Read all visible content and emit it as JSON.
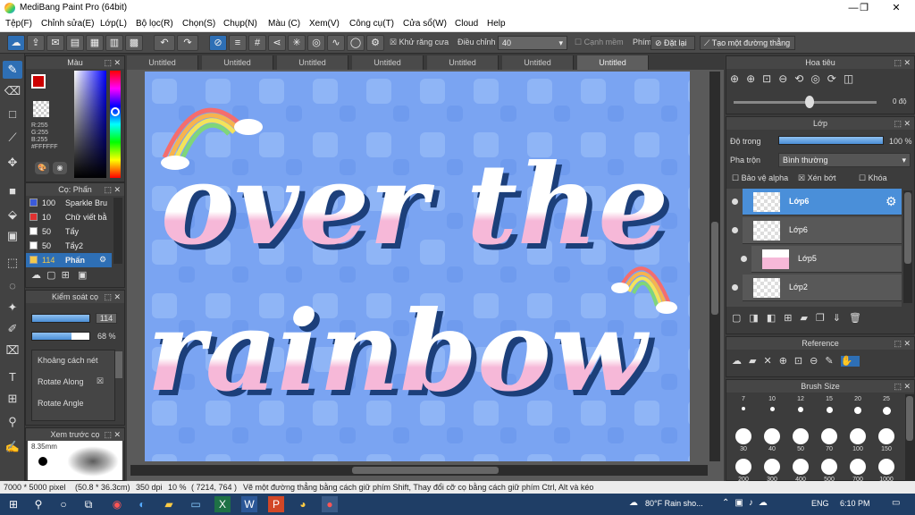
{
  "app": {
    "title": "MediBang Paint Pro (64bit)"
  },
  "menu": [
    "Tệp(F)",
    "Chỉnh sửa(E)",
    "Lớp(L)",
    "Bộ lọc(R)",
    "Chọn(S)",
    "Chụp(N)",
    "Màu (C)",
    "Xem(V)",
    "Công cụ(T)",
    "Cửa sổ(W)",
    "Cloud",
    "Help"
  ],
  "toolbar": {
    "antialias_label": "Khử răng cưa",
    "adjust_label": "Điều chỉnh",
    "adjust_value": "40",
    "soft_edge_label": "Cạnh mềm",
    "key_label": "Phím",
    "reset_label": "Đặt lại",
    "straight_line_label": "Tạo một đường thẳng"
  },
  "tabs": [
    "Untitled",
    "Untitled",
    "Untitled",
    "Untitled",
    "Untitled",
    "Untitled",
    "Untitled"
  ],
  "color_panel": {
    "title": "Màu",
    "r": "R:255",
    "g": "G:255",
    "b": "B:255",
    "hex": "#FFFFFF"
  },
  "brush_panel": {
    "title": "Cọ: Phấn",
    "items": [
      {
        "size": "100",
        "name": "Sparkle Bru",
        "color": "#3b5bdb"
      },
      {
        "size": "10",
        "name": "Chữ viết bằ",
        "color": "#e03131"
      },
      {
        "size": "50",
        "name": "Tẩy",
        "color": "#ffffff"
      },
      {
        "size": "50",
        "name": "Tẩy2",
        "color": "#ffffff"
      },
      {
        "size": "114",
        "name": "Phấn",
        "color": "#f2c94c"
      }
    ]
  },
  "brush_control": {
    "title": "Kiểm soát cọ",
    "size": "114",
    "opacity": "68 %",
    "opt1": "Khoảng cách nét",
    "opt2": "Rotate Along",
    "opt3": "Rotate Angle"
  },
  "preview": {
    "title": "Xem trước cọ",
    "size": "8.35mm"
  },
  "navigator": {
    "title": "Hoa tiêu",
    "angle": "0 độ"
  },
  "layer_panel": {
    "title": "Lớp",
    "opacity_label": "Độ trong",
    "opacity_value": "100 %",
    "blend_label": "Pha trộn",
    "blend_value": "Bình thường",
    "protect_alpha": "Bảo vệ alpha",
    "clip": "Xén bớt",
    "lock": "Khóa",
    "layers": [
      "Lớp6",
      "Lớp6",
      "Lớp5",
      "Lớp2"
    ]
  },
  "reference": {
    "title": "Reference"
  },
  "brush_size": {
    "title": "Brush Size",
    "row1": [
      "7",
      "10",
      "12",
      "15",
      "20",
      "25"
    ],
    "row2": [
      "30",
      "40",
      "50",
      "70",
      "100",
      "150"
    ],
    "row3": [
      "200",
      "300",
      "400",
      "500",
      "700",
      "1000"
    ]
  },
  "status": {
    "dimensions": "7000 * 5000 pixel",
    "size_cm": "(50.8 * 36.3cm)",
    "dpi": "350 dpi",
    "zoom": "10 %",
    "coords": "( 7214, 764 )",
    "hint": "Vẽ một đường thẳng bằng cách giữ phím Shift, Thay đổi cỡ cọ bằng cách giữ phím Ctrl, Alt và kéo"
  },
  "artwork": {
    "line1": "over the",
    "line2": "rainbow"
  },
  "taskbar": {
    "weather": "80°F  Rain sho...",
    "lang": "ENG",
    "time": "6:10 PM"
  },
  "colors": {
    "accent": "#2e6fb5",
    "canvas_bg": "#7aa4f2",
    "letter_fill": "#ffffff",
    "letter_pink": "#f6b8d8",
    "letter_shadow": "#1c3f7a"
  }
}
